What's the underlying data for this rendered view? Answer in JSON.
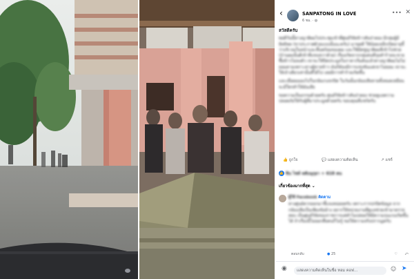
{
  "facebook_post": {
    "page_name": "SANPATONG IN LOVE",
    "post_meta": "6 ชม.",
    "greeting": "สวัสดีครับ",
    "paragraph_1": "พอดีวันนี้ทางญาติผมไปประชุมเข้าที่ศูนย์วิจัยข้าวสันป่าตอง มีกลุ่มผู้มีอิทธิพล (ขาประกาศด้วยแบบนั้นนะครับ) มาขุดดี ใช้น้อยเหล็กเปิดอายุขี้ว่าบริเวณในหน้าและหิ้นพร้อมของผม และใช้มีดขู่ญาติผมที่เข้าไปช่วย (บ้านผมนั้นดีเข้าที่แขนขวาด้วย) เรื่องเกิดจากกลุ่มคนที่รุมทำร้ายจะขายซื้อข้าวไม่ลงตัว เขาจะให้ปิดประมูลในราคาเริ่มต้นแล้วทางญาติผมไม่ไม่ยอมตามเพราะทางผู้ขายข้าว มันก็ต้องมีการแข่งขันแต่เขาไม่ยอม เขาจะให้เจ้าเดียวเท่านั้นที่ได้ไป เลยมีการทำร้ายเกิดขึ้น",
    "paragraph_2": "และเมื่อผมมองไปในกล้องวงจรปิด ในวันนั้นกล้องเสียหายทั้งหมดเหมือนจะมีใครทำให้มันเสีย",
    "paragraph_3": "ขอความเป็นธรรมด้วยครับ ศูนย์วิจัยข้าวสันป่าตอง ช่วยดูแลความปลอดภัยให้กับผู้ที่มาประมูลด้วยครับ ขอบคุณที่แชร์ครับ",
    "actions": {
      "like": "ถูกใจ",
      "comment": "แสดงความคิดเห็น",
      "share": "แชร์"
    },
    "reactions_text": "ชิน ไชท์ หลับนุกุยา + 618 คน",
    "sort_label": "เกี่ยวข้องมากที่สุด",
    "comment": {
      "author": "ผู้ใช้ Facebook",
      "badge": "ติดตาม",
      "text": "ทางศูนย์ควรออกมาชี้แจงหน่อยครับ เพราะการปกปิดข้อมูล จากกล้องเสียเป็นเพียงข้ออ้าง อยากให้หน่วยงานที่ดูแลช่วยเข้ามาตรวจสอบ เป็นศูนย์วิจัยของราชการแต่ทำไมปล่อยให้มีความรุนแรงเกิดขึ้นได้ ถ้าเรื่องนี้ไม่ออกสื่อคนก็ไม่รู้ ขอให้ความจริงปรากฏครับ",
      "meta": "ตอบกลับ",
      "count": "25"
    },
    "composer_placeholder": "แสดงความคิดเห็นในชื่อ ทอม คอฟ…"
  },
  "photo_colors": {
    "sky": "#dfe4e3",
    "building_left": "#d1c6b8",
    "pillar": "#d48f7c",
    "floor": "#9a9a95",
    "tree": "#2f5a2c",
    "wall_right": "#d2988a",
    "stone": "#8a8a6a"
  }
}
